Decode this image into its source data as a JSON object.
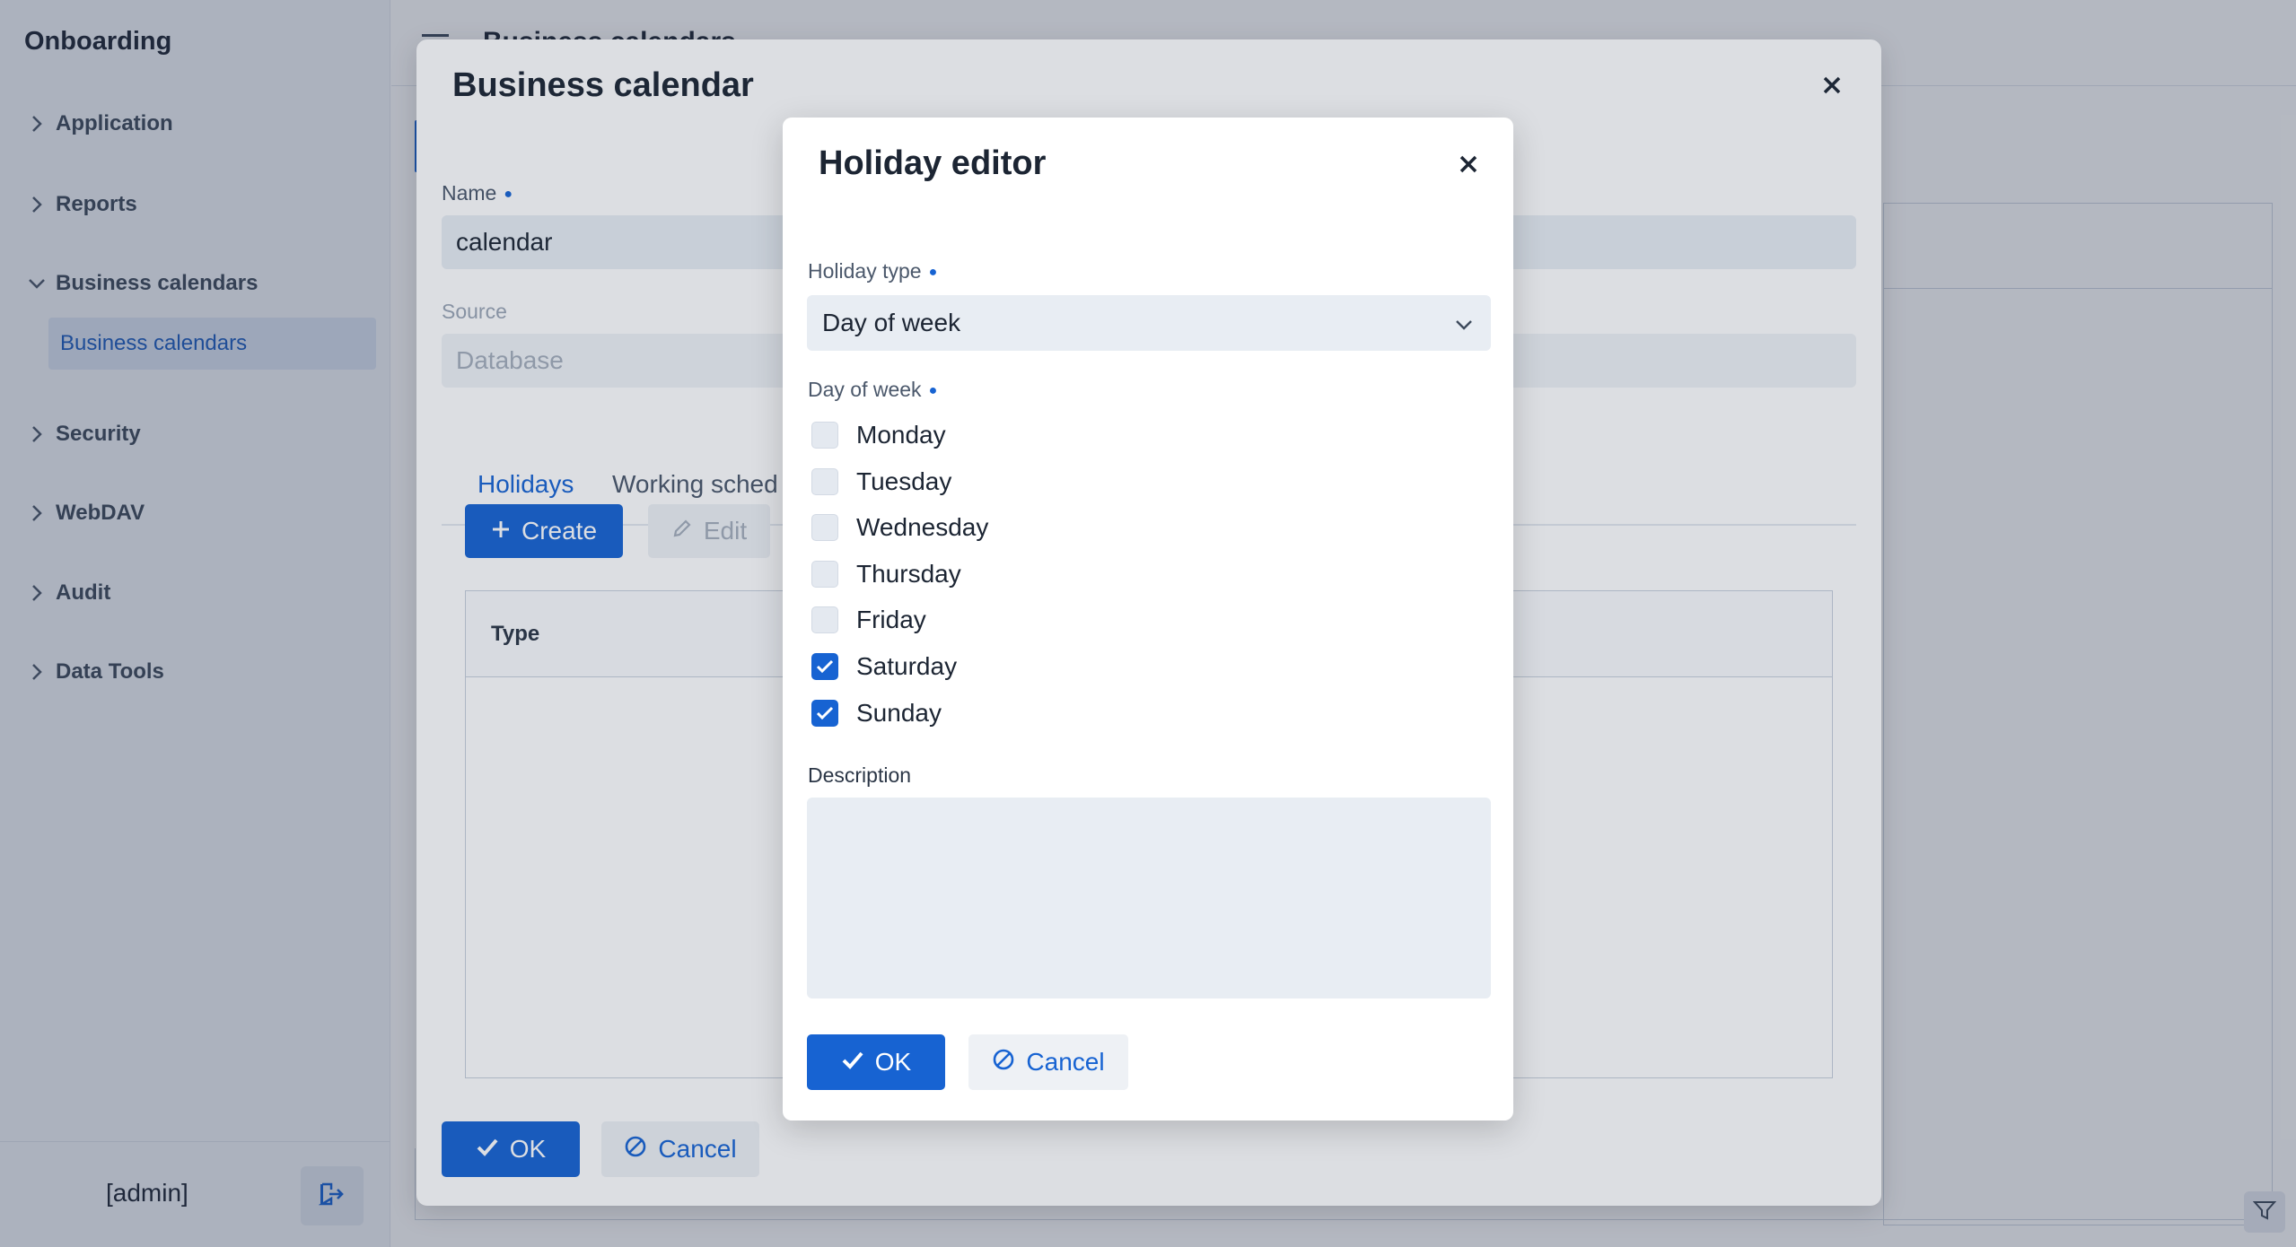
{
  "sidebar": {
    "app_title": "Onboarding",
    "items": [
      {
        "label": "Application",
        "expanded": false
      },
      {
        "label": "Reports",
        "expanded": false
      },
      {
        "label": "Business calendars",
        "expanded": true
      },
      {
        "label": "Security",
        "expanded": false
      },
      {
        "label": "WebDAV",
        "expanded": false
      },
      {
        "label": "Audit",
        "expanded": false
      },
      {
        "label": "Data Tools",
        "expanded": false
      }
    ],
    "sub_item": "Business calendars",
    "user": "[admin]"
  },
  "topbar": {
    "title": "Business calendars"
  },
  "calendar_dialog": {
    "title": "Business calendar",
    "name_label": "Name",
    "name_value": "calendar",
    "source_label": "Source",
    "source_value": "Database",
    "tabs": [
      "Holidays",
      "Working sched"
    ],
    "create_label": "Create",
    "edit_label": "Edit",
    "table_header": "Type",
    "ok_label": "OK",
    "cancel_label": "Cancel"
  },
  "holiday_dialog": {
    "title": "Holiday editor",
    "type_label": "Holiday type",
    "type_value": "Day of week",
    "dow_label": "Day of week",
    "days": [
      {
        "label": "Monday",
        "checked": false
      },
      {
        "label": "Tuesday",
        "checked": false
      },
      {
        "label": "Wednesday",
        "checked": false
      },
      {
        "label": "Thursday",
        "checked": false
      },
      {
        "label": "Friday",
        "checked": false
      },
      {
        "label": "Saturday",
        "checked": true
      },
      {
        "label": "Sunday",
        "checked": true
      }
    ],
    "description_label": "Description",
    "description_value": "",
    "ok_label": "OK",
    "cancel_label": "Cancel"
  },
  "colors": {
    "accent": "#1763d2",
    "field_bg": "#e8edf3"
  }
}
